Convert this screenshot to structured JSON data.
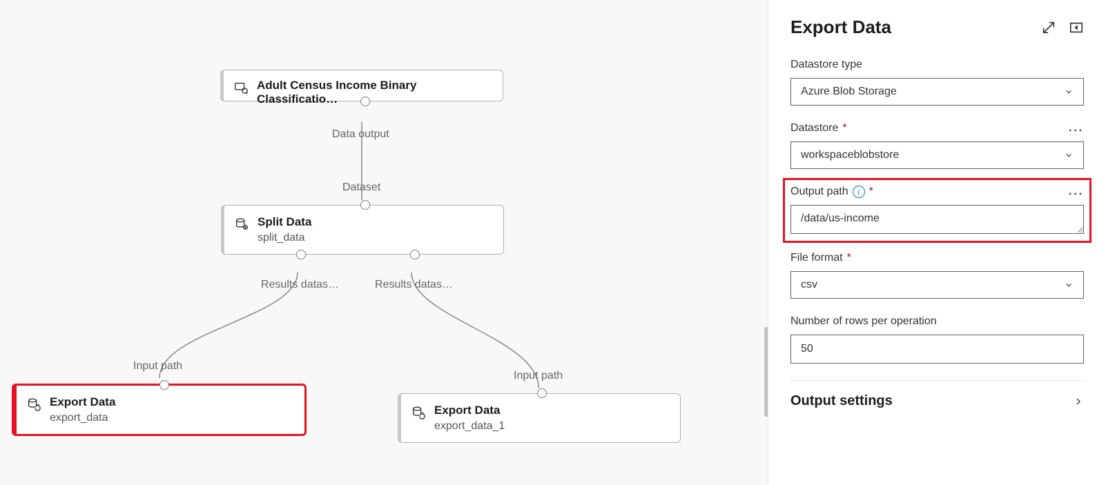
{
  "canvas": {
    "node_dataset": {
      "title": "Adult Census Income Binary Classificatio…",
      "out_label": "Data output"
    },
    "node_split": {
      "title": "Split Data",
      "subtitle": "split_data",
      "in_label": "Dataset",
      "out1_label": "Results datas…",
      "out2_label": "Results datas…"
    },
    "node_export1": {
      "title": "Export Data",
      "subtitle": "export_data",
      "in_label": "Input path"
    },
    "node_export2": {
      "title": "Export Data",
      "subtitle": "export_data_1",
      "in_label": "Input path"
    }
  },
  "panel": {
    "title": "Export Data",
    "datastore_type": {
      "label": "Datastore type",
      "value": "Azure Blob Storage"
    },
    "datastore": {
      "label": "Datastore",
      "value": "workspaceblobstore"
    },
    "output_path": {
      "label": "Output path",
      "value": "/data/us-income"
    },
    "file_format": {
      "label": "File format",
      "value": "csv"
    },
    "rows": {
      "label": "Number of rows per operation",
      "value": "50"
    },
    "output_settings": "Output settings"
  }
}
